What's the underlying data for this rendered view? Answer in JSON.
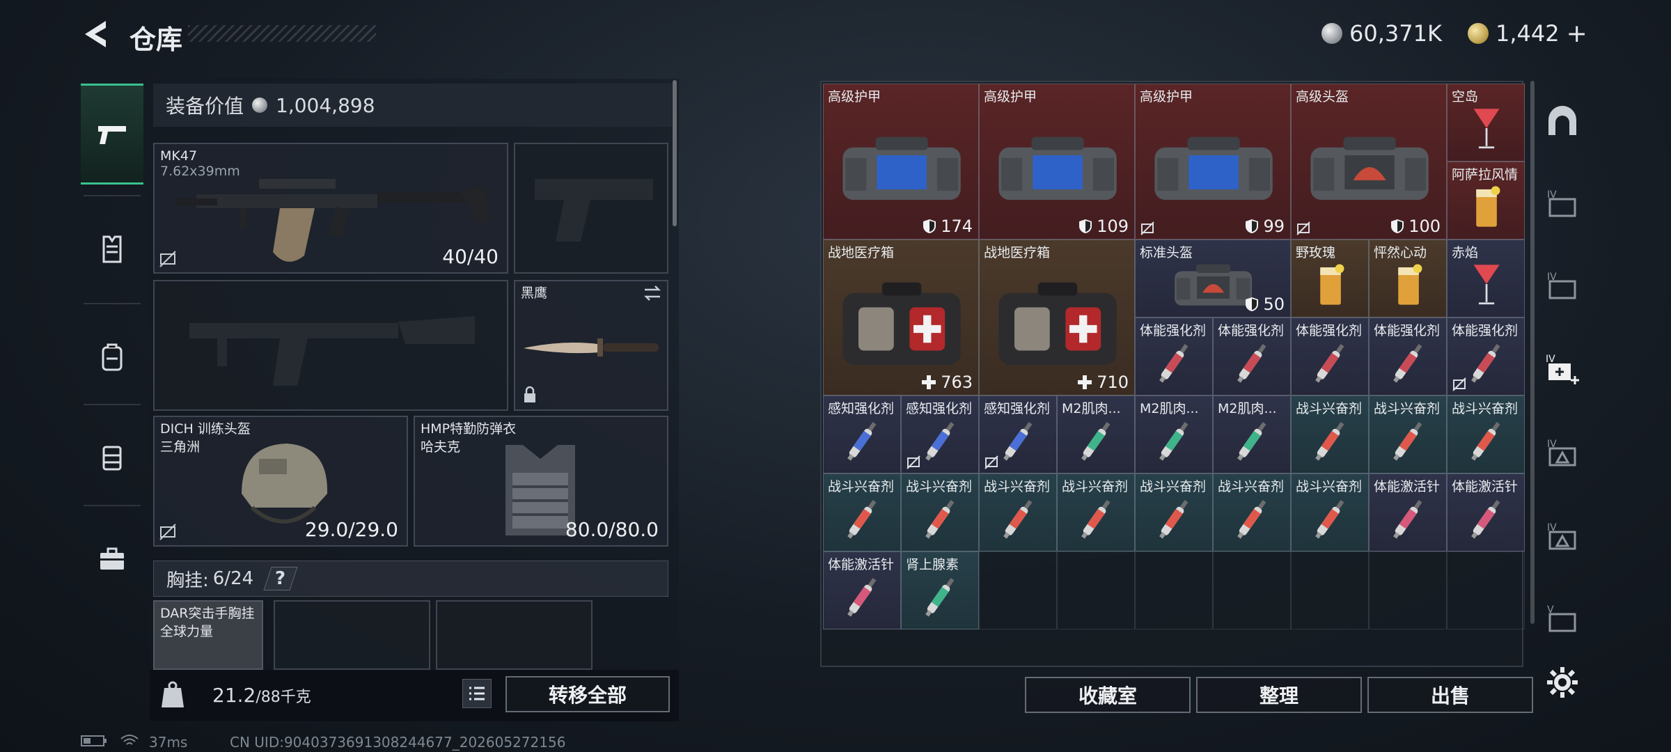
{
  "header": {
    "title": "仓库",
    "silver_amount": "60,371K",
    "gold_amount": "1,442",
    "add_symbol": "+"
  },
  "sidenav": [
    "weapons-icon",
    "armor-vest-icon",
    "backpack-icon",
    "chest-rig-icon",
    "case-icon"
  ],
  "left": {
    "equip_value_label": "装备价值",
    "equip_value": "1,004,898",
    "primary": {
      "name": "MK47",
      "caliber": "7.62x39mm",
      "ammo": "40/40"
    },
    "melee": {
      "name": "黑鹰"
    },
    "helmet": {
      "name": "DICH 训练头盔",
      "sub": "三角洲",
      "durability": "29.0/29.0"
    },
    "armor": {
      "name": "HMP特勤防弹衣",
      "sub": "哈夫克",
      "durability": "80.0/80.0"
    },
    "chest": {
      "label": "胸挂:",
      "count": "6/24",
      "help": "?"
    },
    "rig": {
      "name": "DAR突击手胸挂",
      "sub": "全球力量"
    },
    "weight": "21.2",
    "weight_max": "/88千克",
    "transfer_all": "转移全部"
  },
  "stash_buttons": {
    "collection": "收藏室",
    "sort": "整理",
    "sell": "出售"
  },
  "stash": {
    "items": [
      {
        "label": "高级护甲",
        "value": "174",
        "kind": "shield"
      },
      {
        "label": "高级护甲",
        "value": "109",
        "kind": "shield"
      },
      {
        "label": "高级护甲",
        "value": "99",
        "kind": "shield"
      },
      {
        "label": "高级头盔",
        "value": "100",
        "kind": "shield"
      },
      {
        "label": "空岛"
      },
      {
        "label": "阿萨拉风情"
      },
      {
        "label": "战地医疗箱",
        "value": "763",
        "kind": "heal"
      },
      {
        "label": "战地医疗箱",
        "value": "710",
        "kind": "heal"
      },
      {
        "label": "标准头盔",
        "value": "50",
        "kind": "shield"
      },
      {
        "label": "野玫瑰"
      },
      {
        "label": "怦然心动"
      },
      {
        "label": "赤焰"
      },
      {
        "label": "体能强化剂"
      },
      {
        "label": "体能强化剂"
      },
      {
        "label": "体能强化剂"
      },
      {
        "label": "体能强化剂"
      },
      {
        "label": "体能强化剂"
      },
      {
        "label": "感知强化剂"
      },
      {
        "label": "感知强化剂"
      },
      {
        "label": "感知强化剂"
      },
      {
        "label": "M2肌肉..."
      },
      {
        "label": "M2肌肉..."
      },
      {
        "label": "M2肌肉..."
      },
      {
        "label": "战斗兴奋剂"
      },
      {
        "label": "战斗兴奋剂"
      },
      {
        "label": "战斗兴奋剂"
      },
      {
        "label": "战斗兴奋剂"
      },
      {
        "label": "战斗兴奋剂"
      },
      {
        "label": "战斗兴奋剂"
      },
      {
        "label": "战斗兴奋剂"
      },
      {
        "label": "战斗兴奋剂"
      },
      {
        "label": "战斗兴奋剂"
      },
      {
        "label": "战斗兴奋剂"
      },
      {
        "label": "体能激活针"
      },
      {
        "label": "体能激活针"
      },
      {
        "label": "体能激活针"
      },
      {
        "label": "肾上腺素"
      }
    ]
  },
  "status": {
    "ping": "37ms",
    "uid": "CN UID:9040373691308244677_202605272156"
  },
  "colors": {
    "accent_green": "#39c18d",
    "red_item": "#5a2526",
    "brown_item": "#4b3a2b",
    "navy_item": "#2f3349",
    "teal_item": "#27404a"
  }
}
